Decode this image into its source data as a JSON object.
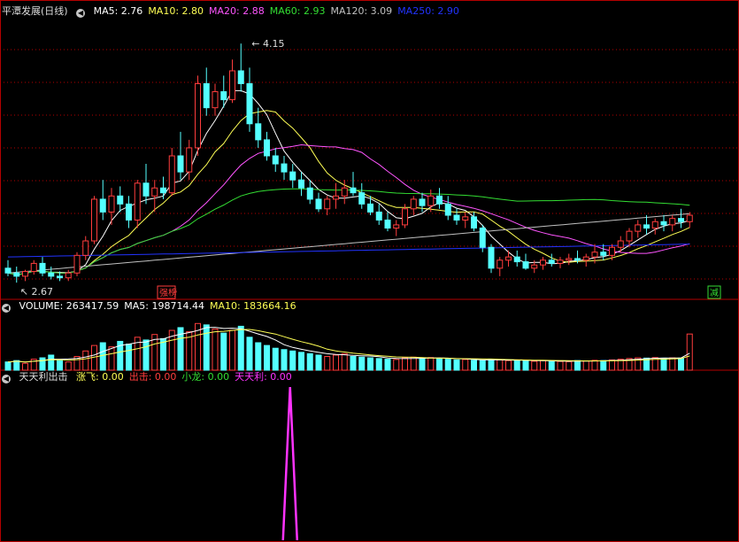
{
  "colors": {
    "bg": "#000000",
    "frame": "#b40000",
    "grid": "#b40000",
    "up": "#ff3d3d",
    "down": "#54ffff",
    "ma5": "#ffffff",
    "ma10": "#ffff55",
    "ma20": "#ff55ff",
    "ma60": "#33dd33",
    "ma120": "#c0c0c0",
    "ma250": "#2233ff",
    "signal": "#ff33ff"
  },
  "main_panel": {
    "title": "平潭发展(日线)",
    "ma_labels": [
      {
        "text": "MA5: 2.76",
        "color": "#ffffff"
      },
      {
        "text": "MA10: 2.80",
        "color": "#ffff55"
      },
      {
        "text": "MA20: 2.88",
        "color": "#ff55ff"
      },
      {
        "text": "MA60: 2.93",
        "color": "#33dd33"
      },
      {
        "text": "MA120: 3.09",
        "color": "#c0c0c0"
      },
      {
        "text": "MA250: 2.90",
        "color": "#2233ff"
      }
    ],
    "high_label": "4.15",
    "low_label": "2.67",
    "badge_left": "强榜",
    "badge_right": "减"
  },
  "volume_panel": {
    "labels": [
      {
        "text": "VOLUME: 263417.59",
        "color": "#ffffff"
      },
      {
        "text": "MA5: 198714.44",
        "color": "#ffffff"
      },
      {
        "text": "MA10: 183664.16",
        "color": "#ffff55"
      }
    ]
  },
  "indicator_panel": {
    "title": "天天利出击",
    "labels": [
      {
        "text": "涨飞: 0.00",
        "color": "#ffff55"
      },
      {
        "text": "出击: 0.00",
        "color": "#ff3d3d"
      },
      {
        "text": "小龙: 0.00",
        "color": "#33dd33"
      },
      {
        "text": "天天利: 0.00",
        "color": "#ff33ff"
      }
    ]
  },
  "chart_data": [
    {
      "type": "candlestick",
      "title": "平潭发展(日线)",
      "ylim": [
        2.6,
        4.3
      ],
      "candles": [
        [
          2.75,
          2.8,
          2.7,
          2.72
        ],
        [
          2.72,
          2.76,
          2.66,
          2.7
        ],
        [
          2.7,
          2.74,
          2.67,
          2.73
        ],
        [
          2.73,
          2.8,
          2.71,
          2.78
        ],
        [
          2.78,
          2.82,
          2.7,
          2.72
        ],
        [
          2.72,
          2.76,
          2.68,
          2.7
        ],
        [
          2.7,
          2.73,
          2.67,
          2.69
        ],
        [
          2.69,
          2.74,
          2.67,
          2.72
        ],
        [
          2.72,
          2.85,
          2.7,
          2.83
        ],
        [
          2.83,
          2.95,
          2.8,
          2.92
        ],
        [
          2.92,
          3.2,
          2.9,
          3.18
        ],
        [
          3.18,
          3.3,
          3.05,
          3.1
        ],
        [
          3.1,
          3.25,
          3.02,
          3.2
        ],
        [
          3.2,
          3.26,
          3.1,
          3.15
        ],
        [
          3.15,
          3.2,
          3.0,
          3.05
        ],
        [
          3.05,
          3.3,
          3.0,
          3.28
        ],
        [
          3.28,
          3.4,
          3.15,
          3.2
        ],
        [
          3.2,
          3.3,
          3.1,
          3.25
        ],
        [
          3.25,
          3.32,
          3.18,
          3.22
        ],
        [
          3.22,
          3.5,
          3.2,
          3.45
        ],
        [
          3.45,
          3.6,
          3.3,
          3.35
        ],
        [
          3.35,
          3.55,
          3.3,
          3.5
        ],
        [
          3.5,
          3.95,
          3.45,
          3.9
        ],
        [
          3.9,
          4.0,
          3.7,
          3.75
        ],
        [
          3.75,
          3.9,
          3.7,
          3.85
        ],
        [
          3.85,
          3.95,
          3.75,
          3.8
        ],
        [
          3.8,
          4.05,
          3.78,
          3.98
        ],
        [
          3.98,
          4.15,
          3.85,
          3.9
        ],
        [
          3.9,
          4.0,
          3.6,
          3.65
        ],
        [
          3.65,
          3.75,
          3.5,
          3.55
        ],
        [
          3.55,
          3.6,
          3.42,
          3.45
        ],
        [
          3.45,
          3.5,
          3.35,
          3.4
        ],
        [
          3.4,
          3.45,
          3.3,
          3.35
        ],
        [
          3.35,
          3.4,
          3.25,
          3.3
        ],
        [
          3.3,
          3.35,
          3.2,
          3.25
        ],
        [
          3.25,
          3.3,
          3.15,
          3.18
        ],
        [
          3.18,
          3.22,
          3.1,
          3.12
        ],
        [
          3.12,
          3.2,
          3.08,
          3.18
        ],
        [
          3.18,
          3.28,
          3.12,
          3.2
        ],
        [
          3.2,
          3.3,
          3.15,
          3.25
        ],
        [
          3.25,
          3.35,
          3.2,
          3.22
        ],
        [
          3.22,
          3.28,
          3.12,
          3.15
        ],
        [
          3.15,
          3.2,
          3.08,
          3.1
        ],
        [
          3.1,
          3.15,
          3.02,
          3.05
        ],
        [
          3.05,
          3.1,
          2.98,
          3.0
        ],
        [
          3.0,
          3.05,
          2.95,
          3.02
        ],
        [
          3.02,
          3.15,
          3.0,
          3.12
        ],
        [
          3.12,
          3.2,
          3.08,
          3.18
        ],
        [
          3.18,
          3.22,
          3.1,
          3.14
        ],
        [
          3.14,
          3.24,
          3.1,
          3.2
        ],
        [
          3.2,
          3.25,
          3.12,
          3.15
        ],
        [
          3.15,
          3.2,
          3.05,
          3.08
        ],
        [
          3.08,
          3.12,
          3.02,
          3.05
        ],
        [
          3.05,
          3.1,
          3.0,
          3.07
        ],
        [
          3.07,
          3.1,
          2.98,
          3.0
        ],
        [
          3.0,
          3.02,
          2.85,
          2.88
        ],
        [
          2.88,
          2.9,
          2.72,
          2.75
        ],
        [
          2.75,
          2.82,
          2.7,
          2.8
        ],
        [
          2.8,
          2.86,
          2.76,
          2.82
        ],
        [
          2.82,
          2.86,
          2.76,
          2.79
        ],
        [
          2.79,
          2.84,
          2.74,
          2.75
        ],
        [
          2.75,
          2.8,
          2.72,
          2.77
        ],
        [
          2.77,
          2.82,
          2.74,
          2.8
        ],
        [
          2.8,
          2.84,
          2.76,
          2.78
        ],
        [
          2.78,
          2.82,
          2.75,
          2.8
        ],
        [
          2.8,
          2.84,
          2.77,
          2.81
        ],
        [
          2.81,
          2.86,
          2.78,
          2.8
        ],
        [
          2.8,
          2.84,
          2.76,
          2.82
        ],
        [
          2.82,
          2.9,
          2.78,
          2.85
        ],
        [
          2.85,
          2.9,
          2.8,
          2.83
        ],
        [
          2.83,
          2.9,
          2.8,
          2.88
        ],
        [
          2.88,
          2.95,
          2.85,
          2.92
        ],
        [
          2.92,
          3.0,
          2.88,
          2.98
        ],
        [
          2.98,
          3.05,
          2.94,
          3.02
        ],
        [
          3.02,
          3.08,
          2.96,
          3.0
        ],
        [
          3.0,
          3.06,
          2.96,
          3.04
        ],
        [
          3.04,
          3.08,
          2.98,
          3.02
        ],
        [
          3.02,
          3.08,
          2.98,
          3.06
        ],
        [
          3.06,
          3.12,
          3.0,
          3.04
        ],
        [
          3.04,
          3.1,
          3.0,
          3.08
        ]
      ],
      "ma_series": [
        {
          "name": "MA5",
          "value": 2.76
        },
        {
          "name": "MA10",
          "value": 2.8
        },
        {
          "name": "MA20",
          "value": 2.88
        },
        {
          "name": "MA60",
          "value": 2.93
        },
        {
          "name": "MA120",
          "value": 3.09
        },
        {
          "name": "MA250",
          "value": 2.9
        }
      ],
      "annotations": [
        {
          "text": "4.15",
          "type": "high"
        },
        {
          "text": "2.67",
          "type": "low"
        }
      ]
    },
    {
      "type": "bar",
      "title": "VOLUME",
      "ylim": [
        0,
        400000
      ],
      "values": [
        60000,
        70000,
        50000,
        80000,
        90000,
        110000,
        70000,
        60000,
        100000,
        140000,
        180000,
        200000,
        170000,
        210000,
        190000,
        240000,
        220000,
        260000,
        230000,
        290000,
        310000,
        280000,
        340000,
        330000,
        300000,
        270000,
        290000,
        320000,
        240000,
        200000,
        180000,
        160000,
        150000,
        140000,
        130000,
        120000,
        110000,
        100000,
        110000,
        120000,
        100000,
        95000,
        90000,
        85000,
        80000,
        78000,
        90000,
        95000,
        88000,
        92000,
        85000,
        80000,
        75000,
        78000,
        72000,
        70000,
        80000,
        75000,
        70000,
        72000,
        68000,
        65000,
        70000,
        66000,
        64000,
        62000,
        70000,
        68000,
        72000,
        70000,
        75000,
        80000,
        85000,
        90000,
        88000,
        92000,
        86000,
        90000,
        88000,
        263417.59
      ],
      "ma5": 198714.44,
      "ma10": 183664.16
    },
    {
      "type": "line",
      "title": "天天利出击",
      "ylim": [
        0,
        1
      ],
      "series": [
        {
          "name": "天天利",
          "spike_index": 40,
          "value": 1
        }
      ]
    }
  ]
}
